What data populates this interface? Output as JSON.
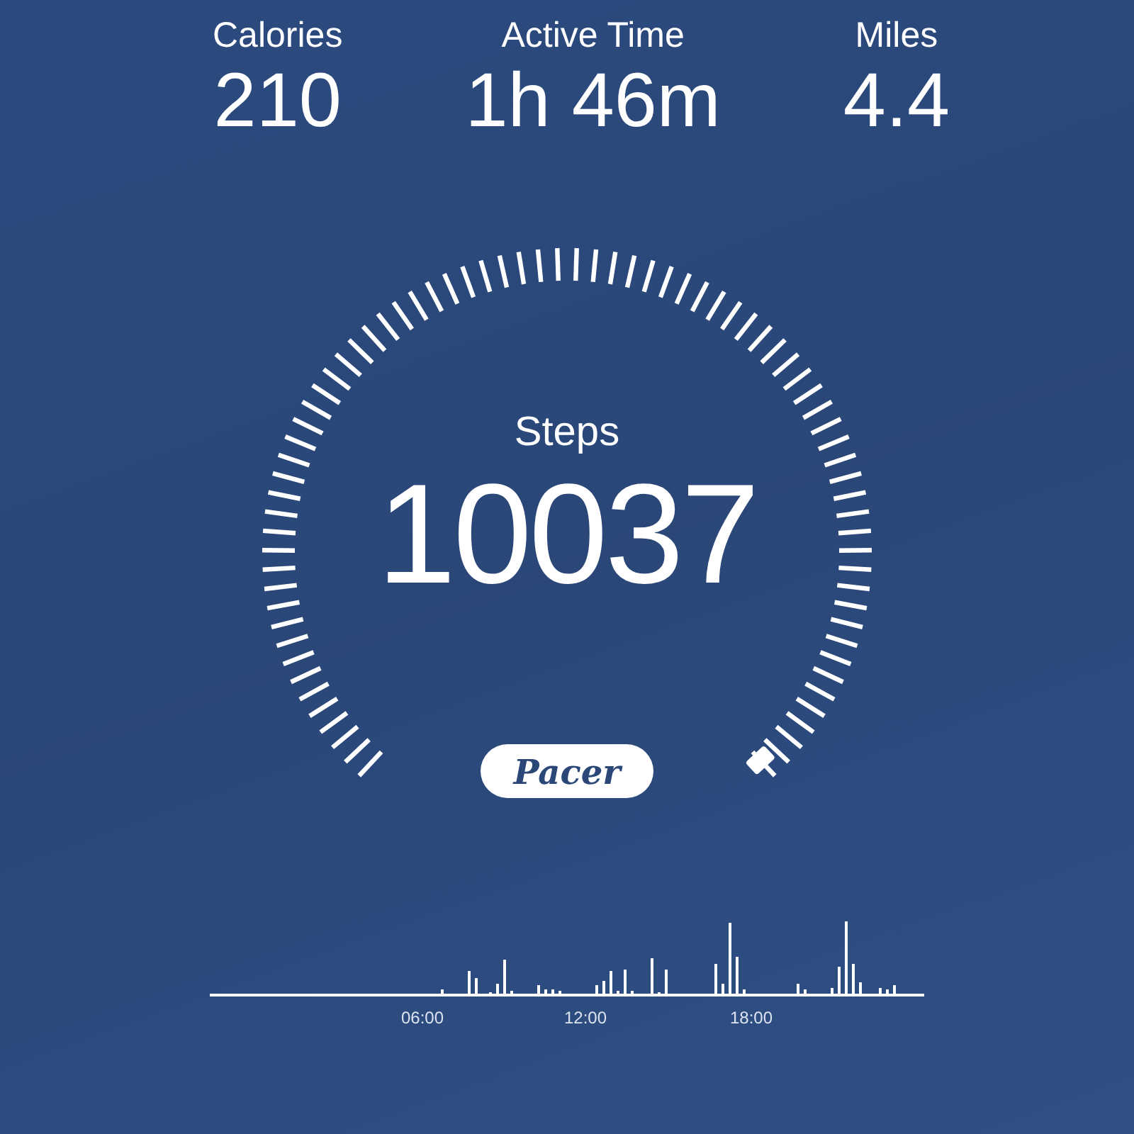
{
  "stats": [
    {
      "label": "Calories",
      "value": "210"
    },
    {
      "label": "Active Time",
      "value": "1h 46m"
    },
    {
      "label": "Miles",
      "value": "4.4"
    }
  ],
  "gauge": {
    "label": "Steps",
    "value": "10037"
  },
  "badge": "Pacer",
  "timeline": {
    "labels": [
      "06:00",
      "12:00",
      "18:00"
    ]
  }
}
